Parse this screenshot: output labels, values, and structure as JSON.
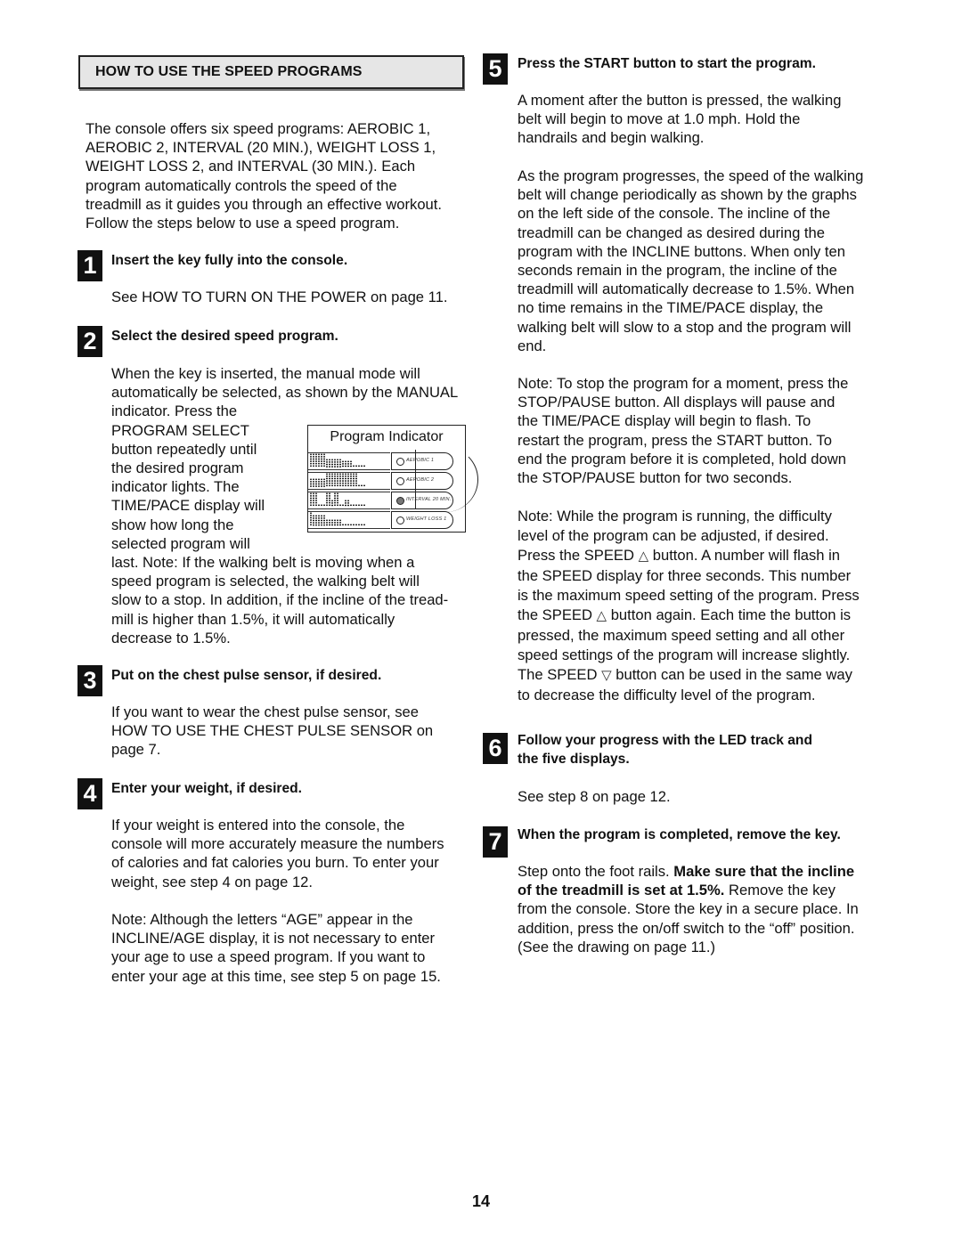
{
  "section": {
    "title": "HOW TO USE THE SPEED PROGRAMS",
    "intro": [
      "The console offers six speed programs: AEROBIC 1,",
      "AEROBIC 2, INTERVAL (20 MIN.), WEIGHT LOSS 1,",
      "WEIGHT LOSS 2, and INTERVAL (30 MIN.). Each",
      "program automatically controls the speed of the",
      "treadmill as it guides you through an effective workout.",
      "Follow the steps below to use a speed program."
    ]
  },
  "steps": [
    {
      "number": "1",
      "heading": "Insert the key fully into the console.",
      "body": [
        "See HOW TO TURN ON THE POWER on page 11."
      ]
    },
    {
      "number": "2",
      "heading": "Select the desired speed program.",
      "body_top": [
        "When the key is inserted, the manual mode will",
        "automatically be selected, as shown by the MANUAL",
        "indicator. Press the"
      ],
      "body_wrap": [
        "PROGRAM SELECT",
        "button repeatedly until",
        "the desired program",
        "indicator lights. The",
        "TIME/PACE display will",
        "show how long the",
        "selected program will"
      ],
      "body_bottom": [
        "last. Note: If the walking belt is moving when a",
        "speed program is selected, the walking belt will",
        "slow to a stop. In addition, if the incline of the tread-",
        "mill is higher than 1.5%, it will automatically",
        "decrease to 1.5%."
      ]
    },
    {
      "number": "3",
      "heading": "Put on the chest pulse sensor, if desired.",
      "body": [
        "If you want to wear the chest pulse sensor, see",
        "HOW TO USE THE CHEST PULSE SENSOR on",
        "page 7."
      ]
    },
    {
      "number": "4",
      "heading": "Enter your weight, if desired.",
      "body": [
        "If your weight is entered into the console, the",
        "console will more accurately measure the numbers",
        "of calories and fat calories you burn. To enter your",
        "weight, see step 4 on page 12."
      ],
      "note": [
        "Note: Although the letters “AGE” appear in the",
        "INCLINE/AGE display, it is not necessary to enter",
        "your age to use a speed program. If you want to",
        "enter your age at this time, see step 5 on page 15."
      ]
    },
    {
      "number": "5",
      "heading": "Press the START button to start the program.",
      "body": [
        "A moment after the button is pressed, the walking",
        "belt will begin to move at 1.0 mph. Hold the",
        "handrails and begin walking."
      ],
      "para2": [
        "As the program progresses, the speed of the walking",
        "belt will change periodically as shown by the graphs",
        "on the left side of the console. The incline of the",
        "treadmill can be changed as desired during the",
        "program with the INCLINE buttons. When only ten",
        "seconds remain in the program, the incline of the",
        "treadmill will automatically decrease to 1.5%. When",
        "no time remains in the TIME/PACE display, the",
        "walking belt will slow to a stop and the program will",
        "end."
      ],
      "note1": [
        "Note: To stop the program for a moment, press the",
        "STOP/PAUSE button. All displays will pause and",
        "the TIME/PACE display will begin to flash. To",
        "restart the program, press the START button. To",
        "end the program before it is completed, hold down",
        "the STOP/PAUSE button for two seconds."
      ],
      "note2": [
        {
          "pre": "Note: While the program is running, the difficulty",
          "sym": "",
          "post": ""
        },
        {
          "pre": "level of the program can be adjusted, if desired.",
          "sym": "",
          "post": ""
        },
        {
          "pre": "Press the SPEED ",
          "sym": "△",
          "post": " button. A number will flash in"
        },
        {
          "pre": "the SPEED display for three seconds. This number",
          "sym": "",
          "post": ""
        },
        {
          "pre": "is the maximum speed setting of the program. Press",
          "sym": "",
          "post": ""
        },
        {
          "pre": "the SPEED ",
          "sym": "△",
          "post": " button again. Each time the button is"
        },
        {
          "pre": "pressed, the maximum speed setting and all other",
          "sym": "",
          "post": ""
        },
        {
          "pre": "speed settings of the program will increase slightly.",
          "sym": "",
          "post": ""
        },
        {
          "pre": "The SPEED ",
          "sym": "▽",
          "post": " button can be used in the same way"
        },
        {
          "pre": "to decrease the difficulty level of the program.",
          "sym": "",
          "post": ""
        }
      ]
    },
    {
      "number": "6",
      "heading": [
        "Follow your progress with the LED track and",
        "the five displays."
      ],
      "body": [
        "See step 8 on page 12."
      ]
    },
    {
      "number": "7",
      "heading": "When the program is completed, remove the key.",
      "body": [
        {
          "normal": "Step onto the foot rails. ",
          "bold": "Make sure that the incline"
        },
        {
          "normal": "",
          "bold": "of the treadmill is set at 1.5%.",
          "after": " Remove the key"
        },
        {
          "normal": "from the console. Store the key in a secure place. In",
          "bold": ""
        },
        {
          "normal": "addition, press the on/off switch to the “off” position.",
          "bold": ""
        },
        {
          "normal": "(See the drawing on page 11.)",
          "bold": ""
        }
      ]
    }
  ],
  "program_indicator": {
    "title": "Program Indicator",
    "programs": [
      {
        "label": "AEROBIC 1",
        "lit": false,
        "profile": [
          6,
          6,
          6,
          6,
          6,
          6,
          4,
          4,
          4,
          4,
          4,
          4,
          3,
          3,
          3,
          3,
          1,
          1,
          1,
          1,
          1
        ]
      },
      {
        "label": "AEROBIC 2",
        "lit": false,
        "profile": [
          4,
          4,
          4,
          4,
          4,
          4,
          6,
          6,
          6,
          6,
          6,
          6,
          6,
          6,
          6,
          6,
          6,
          6,
          1,
          1,
          1
        ]
      },
      {
        "label": "INTERVAL 20 MIN.",
        "lit": true,
        "profile": [
          6,
          6,
          6,
          1,
          1,
          1,
          6,
          6,
          3,
          6,
          6,
          1,
          1,
          3,
          3,
          1,
          1,
          1,
          1,
          1,
          1
        ]
      },
      {
        "label": "WEIGHT LOSS 1",
        "lit": false,
        "profile": [
          6,
          5,
          5,
          5,
          5,
          5,
          3,
          3,
          3,
          3,
          3,
          3,
          1,
          1,
          1,
          1,
          1,
          1,
          1,
          1,
          1
        ]
      }
    ]
  },
  "footer": {
    "page_number": "14"
  }
}
